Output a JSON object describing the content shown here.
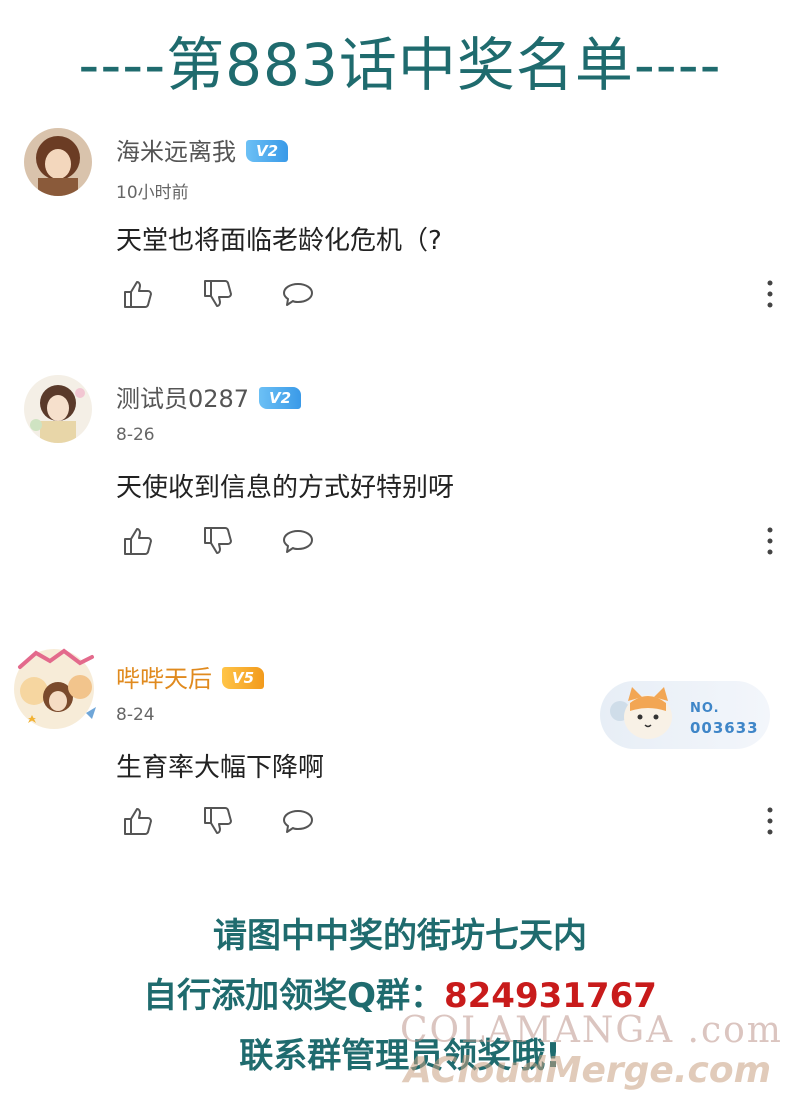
{
  "header": {
    "title": "----第883话中奖名单----"
  },
  "comments": [
    {
      "username": "海米远离我",
      "level": "V2",
      "time": "10小时前",
      "text": "天堂也将面临老龄化危机（?"
    },
    {
      "username": "测试员0287",
      "level": "V2",
      "time": "8-26",
      "text": "天使收到信息的方式好特别呀"
    },
    {
      "username": "哔哔天后",
      "level": "V5",
      "time": "8-24",
      "text": "生育率大幅下降啊",
      "fan_card": {
        "label": "NO.",
        "number": "003633"
      }
    }
  ],
  "footer": {
    "line1": "请图中中奖的街坊七天内",
    "line2_prefix": "自行添加领奖Q群：",
    "line2_qq": "824931767",
    "line3": "联系群管理员领奖哦!"
  },
  "watermark": {
    "line1": "COLAMANGA .com",
    "line2": "ACloudMerge.com"
  },
  "icons": {
    "like": "thumbs-up-icon",
    "dislike": "thumbs-down-icon",
    "reply": "speech-bubble-icon",
    "more": "vertical-dots-icon"
  },
  "colors": {
    "title": "#1f6b6e",
    "qq_number": "#c81b1b",
    "vip_gold": "#e08a1e",
    "level_blue": "#3a9ae8"
  }
}
